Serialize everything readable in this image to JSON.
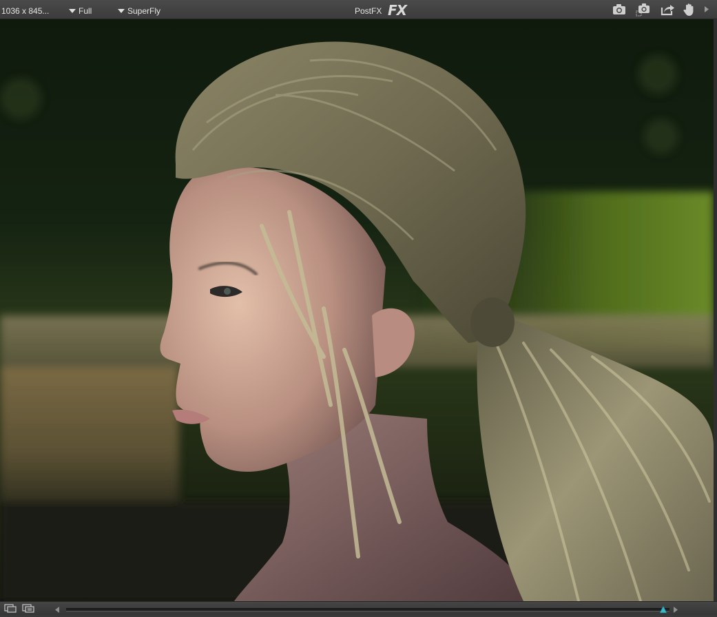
{
  "toolbar": {
    "resolution": "1036 x 845...",
    "render_mode": "Full",
    "render_engine": "SuperFly",
    "postfx_label": "PostFX",
    "fx_logo": "FX",
    "icons": [
      "camera-icon",
      "snapshot-icon",
      "export-icon",
      "hand-icon",
      "more-arrow-icon"
    ]
  },
  "viewport": {
    "content": "render-preview"
  },
  "bottombar": {
    "icons": [
      "render-window-icon",
      "render-queue-icon",
      "scroll-left-icon",
      "scroll-right-icon"
    ],
    "slider_position": 0.99
  },
  "colors": {
    "toolbar_bg": "#3c3c3c",
    "text": "#e6e6e6",
    "slider_accent": "#3fb6c4"
  }
}
